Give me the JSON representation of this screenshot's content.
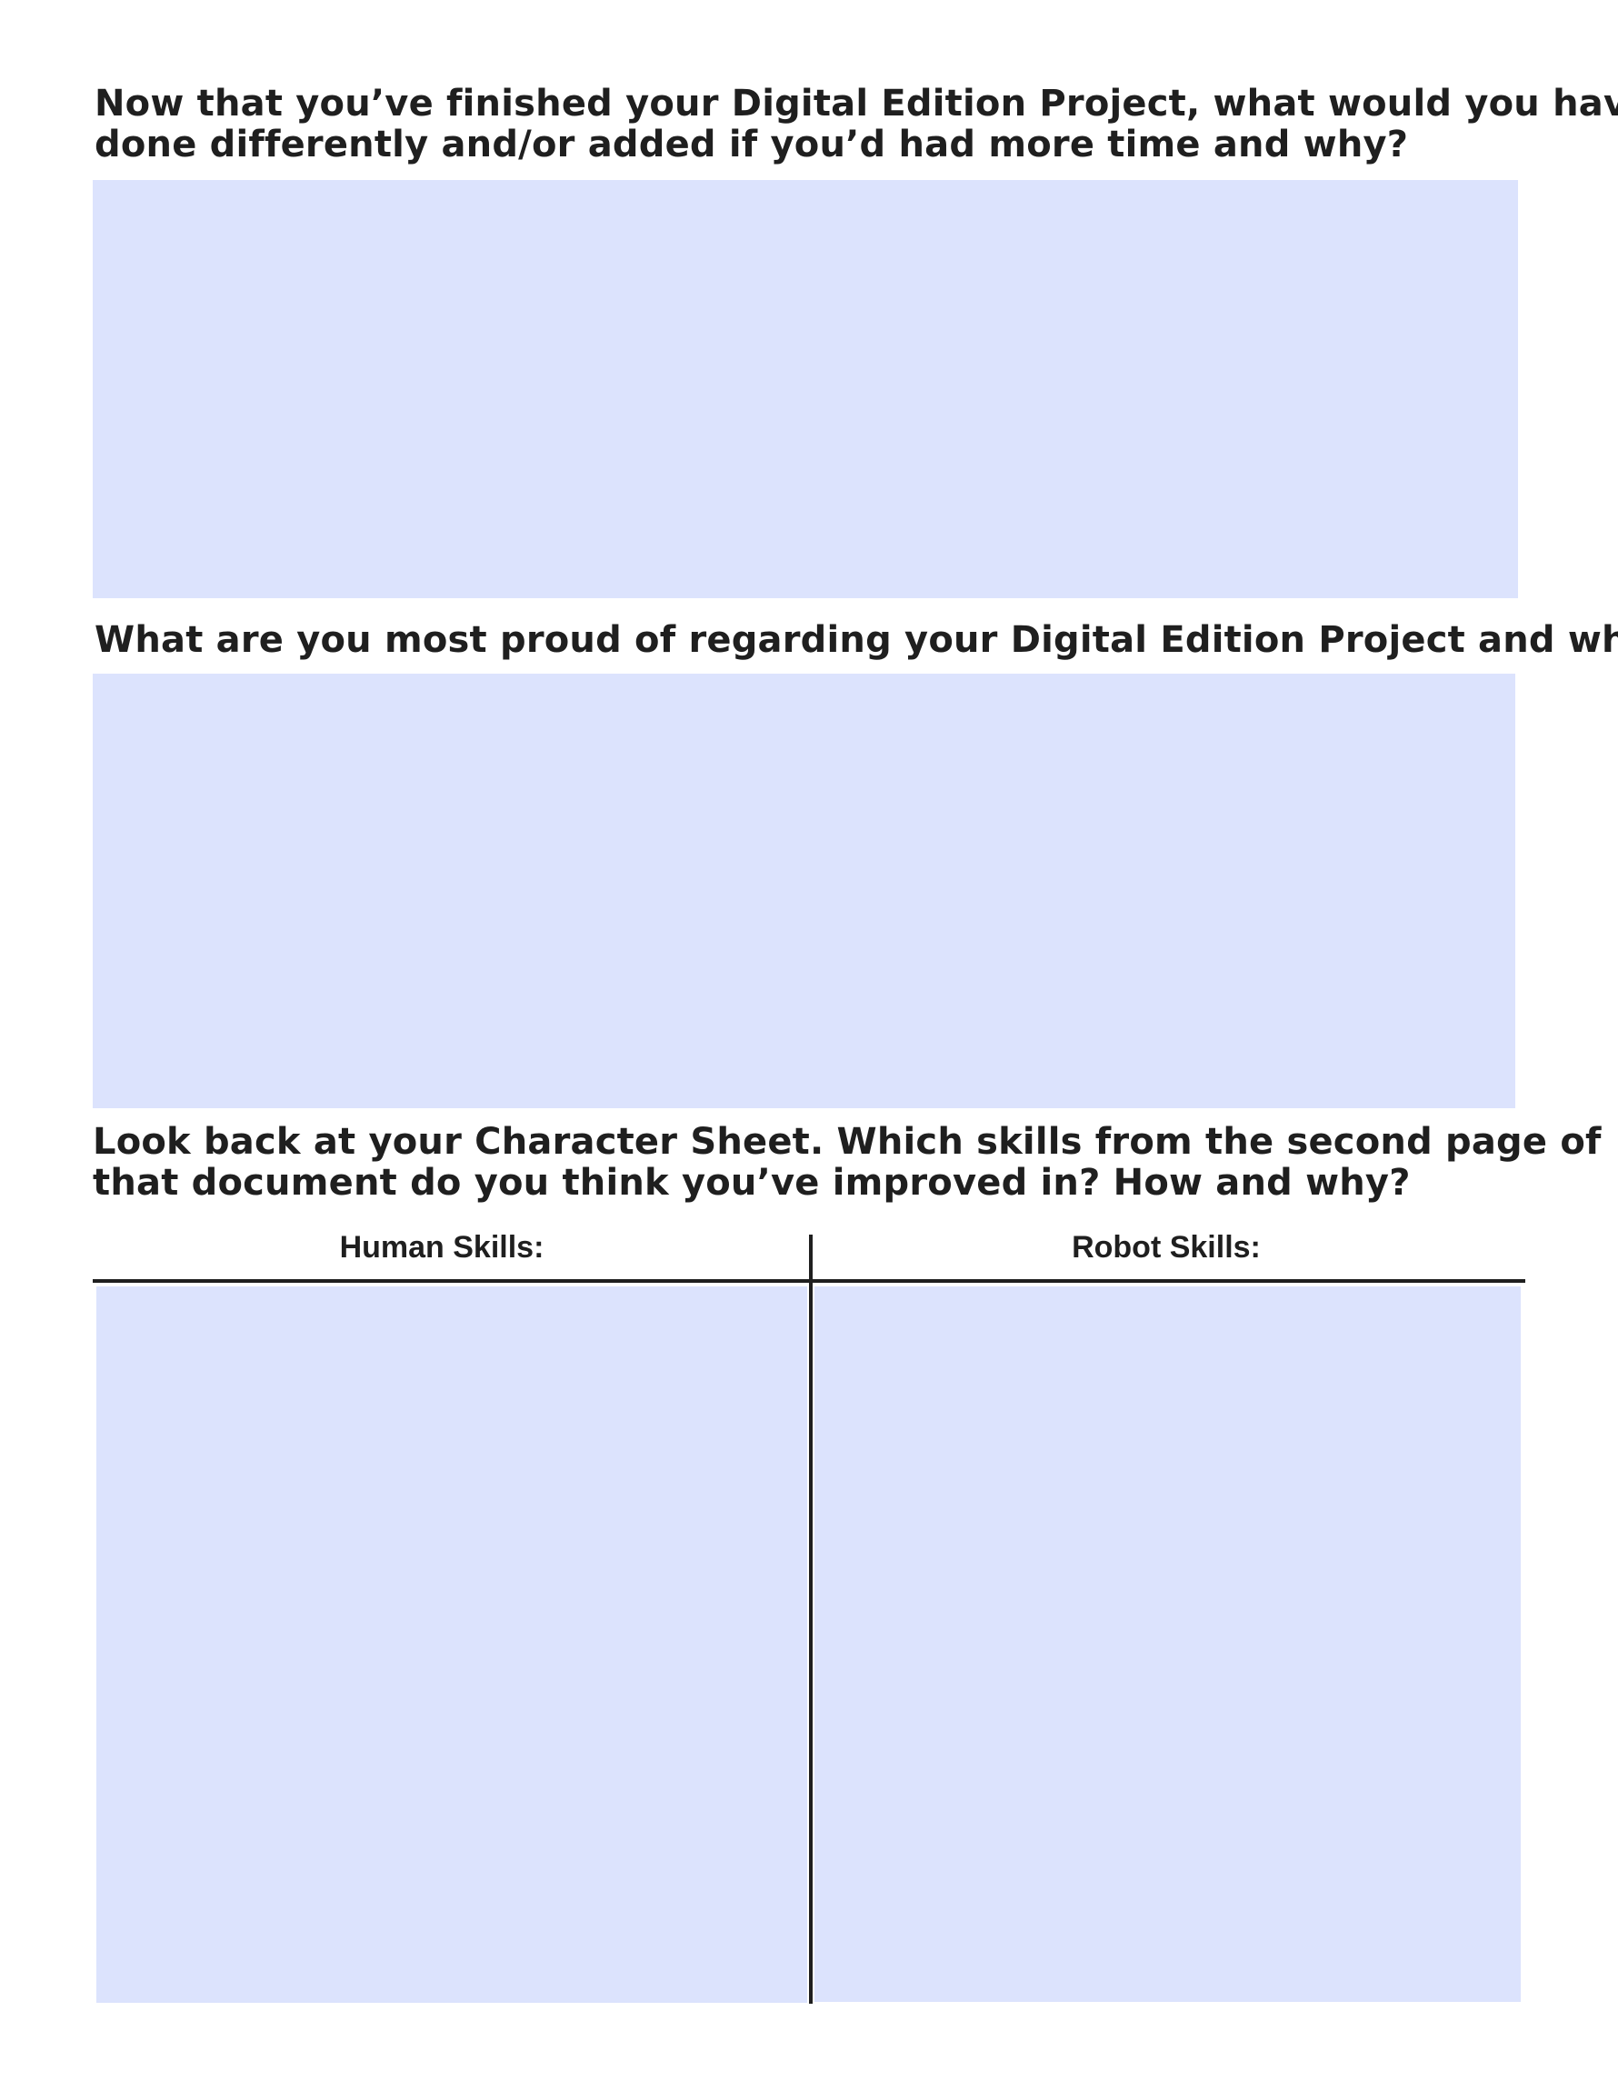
{
  "questions": {
    "q1": {
      "line1": "Now that you’ve finished your Digital Edition Project, what would you have",
      "line2": "done differently and/or added if you’d had more time and why?"
    },
    "q2": {
      "line1": "What are you most proud of regarding your Digital Edition Project and why?"
    },
    "q3": {
      "line1": "Look back at your Character Sheet. Which skills from the second page of",
      "line2": "that document do you think you’ve improved in? How and why?"
    }
  },
  "skills_table": {
    "human_header": "Human Skills:",
    "robot_header": "Robot Skills:"
  },
  "colors": {
    "field_fill": "#dce3fd",
    "text": "#1f1f1f"
  }
}
